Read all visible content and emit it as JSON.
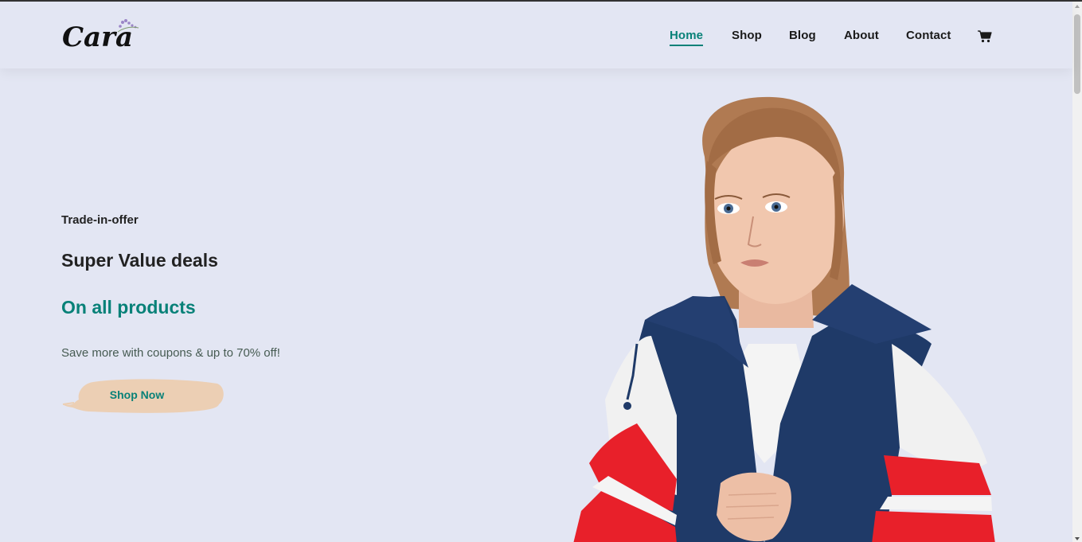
{
  "header": {
    "logo_text": "Cara",
    "nav": [
      {
        "label": "Home",
        "active": true
      },
      {
        "label": "Shop",
        "active": false
      },
      {
        "label": "Blog",
        "active": false
      },
      {
        "label": "About",
        "active": false
      },
      {
        "label": "Contact",
        "active": false
      }
    ],
    "cart_icon": "cart-icon"
  },
  "hero": {
    "eyebrow": "Trade-in-offer",
    "title": "Super Value deals",
    "subtitle": "On all products",
    "description": "Save more with coupons & up to 70% off!",
    "button_label": "Shop Now"
  },
  "colors": {
    "background": "#e3e6f3",
    "accent": "#088178",
    "text_dark": "#222222",
    "button_brush": "#eccfb4"
  }
}
